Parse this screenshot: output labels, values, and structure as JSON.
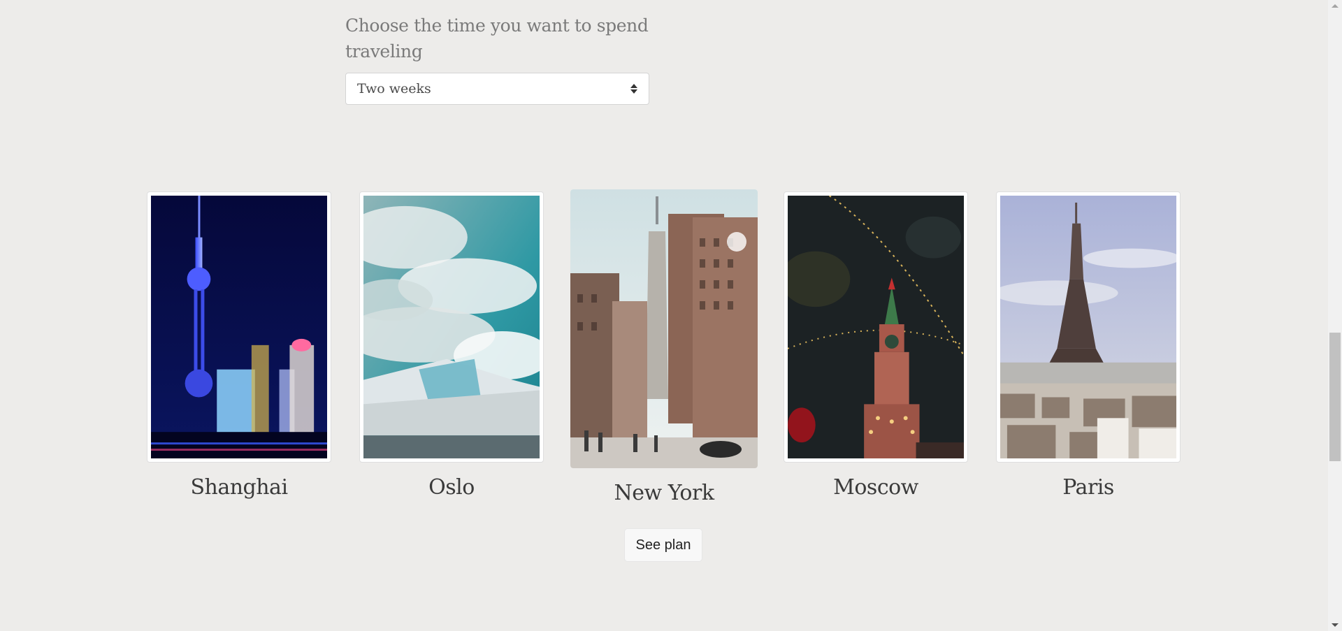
{
  "trip": {
    "duration_label": "Choose the time you want to spend traveling",
    "duration_value": "Two weeks"
  },
  "cities": [
    {
      "name": "Shanghai",
      "image_icon": "shanghai-skyline-photo"
    },
    {
      "name": "Oslo",
      "image_icon": "oslo-opera-house-photo"
    },
    {
      "name": "New York",
      "image_icon": "new-york-street-photo"
    },
    {
      "name": "Moscow",
      "image_icon": "moscow-kremlin-tower-photo"
    },
    {
      "name": "Paris",
      "image_icon": "paris-eiffel-tower-photo"
    }
  ],
  "actions": {
    "see_plan": "See plan"
  },
  "colors": {
    "page_background": "#edecea",
    "card_background": "#ffffff",
    "text": "#3a3a3a",
    "muted_text": "#7a7a7a"
  }
}
